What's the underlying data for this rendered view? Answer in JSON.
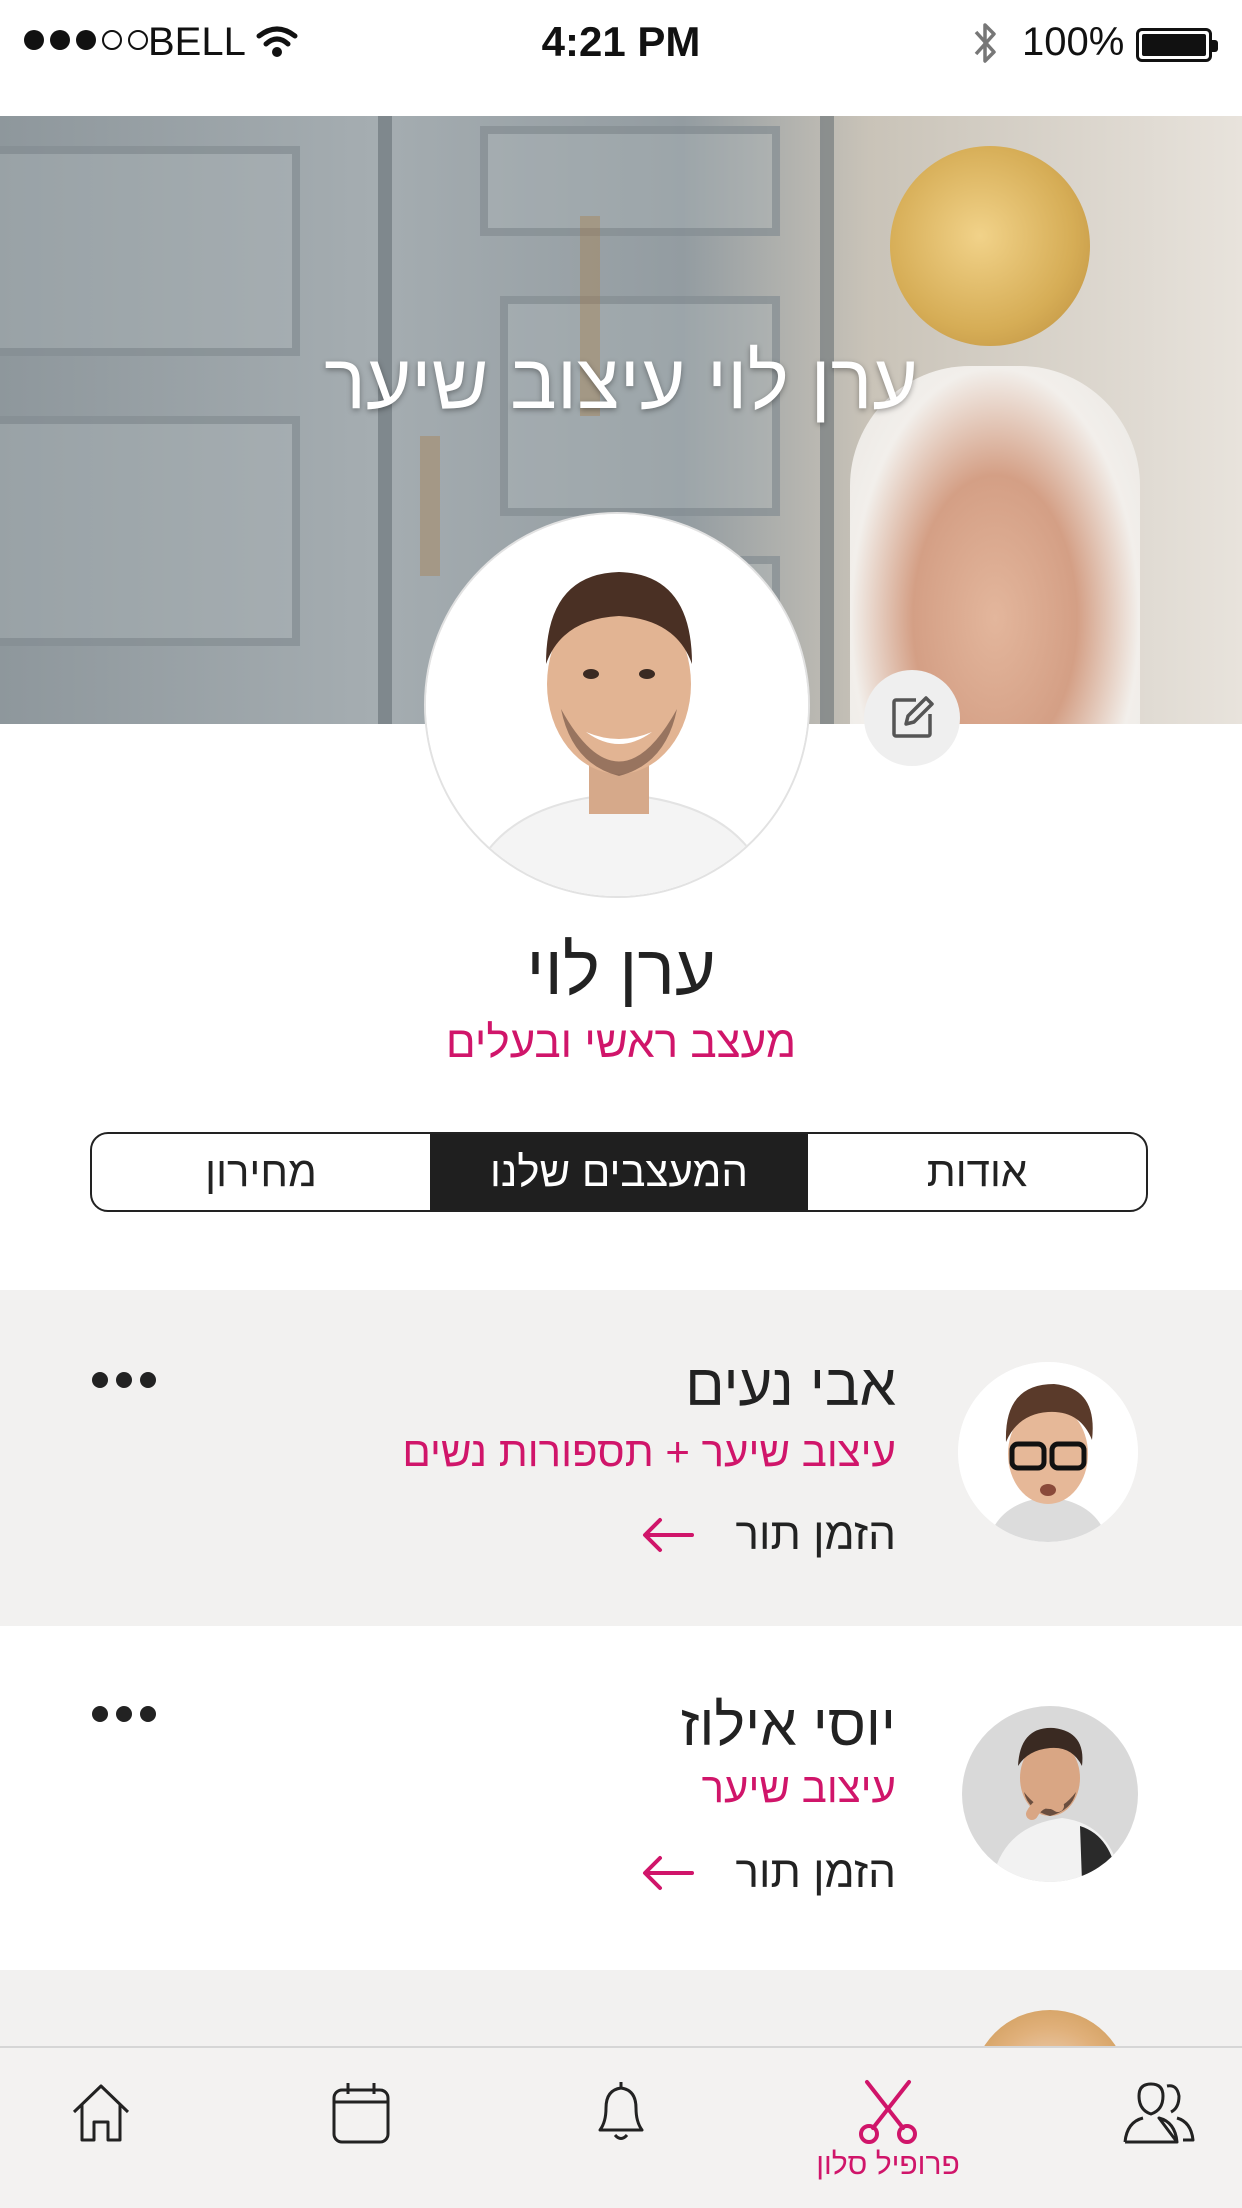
{
  "status_bar": {
    "carrier": "BELL",
    "time": "4:21 PM",
    "battery": "100%"
  },
  "hero": {
    "title": "ערן לוי עיצוב שיער"
  },
  "profile": {
    "name": "ערן לוי",
    "role": "מעצב ראשי ובעלים"
  },
  "tabs": [
    {
      "label": "אודות",
      "active": false
    },
    {
      "label": "המעצבים שלנו",
      "active": true
    },
    {
      "label": "מחירון",
      "active": false
    }
  ],
  "designers": [
    {
      "name": "אבי נעים",
      "specialty": "עיצוב שיער + תספורות נשים",
      "action": "הזמן תור"
    },
    {
      "name": "יוסי אילוז",
      "specialty": "עיצוב שיער",
      "action": "הזמן תור"
    }
  ],
  "bottom_nav": {
    "active_label": "פרופיל סלון",
    "items": [
      "home-icon",
      "calendar-icon",
      "bell-icon",
      "scissors-icon",
      "users-icon"
    ]
  },
  "colors": {
    "accent": "#d0156a",
    "dark": "#1f1f1f",
    "list_bg": "#f2f1f0"
  }
}
